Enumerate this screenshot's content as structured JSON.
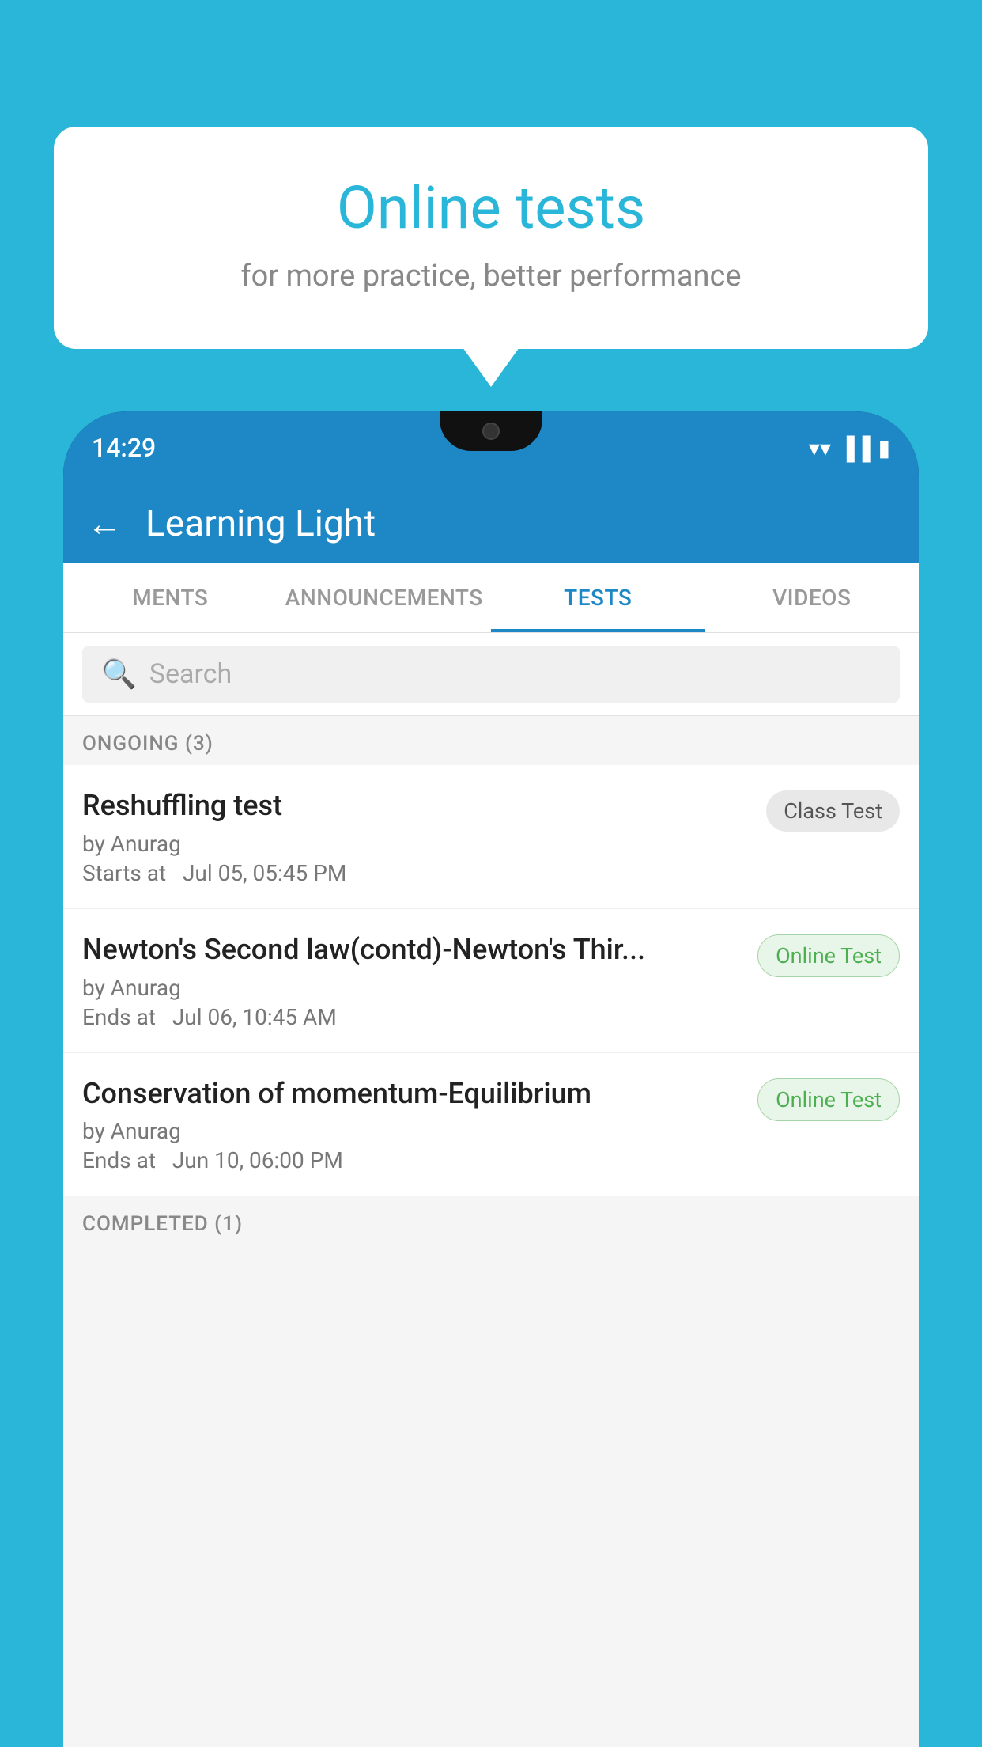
{
  "background": {
    "color": "#29b6d8"
  },
  "speechBubble": {
    "title": "Online tests",
    "subtitle": "for more practice, better performance"
  },
  "phone": {
    "statusBar": {
      "time": "14:29"
    },
    "appBar": {
      "title": "Learning Light",
      "backLabel": "←"
    },
    "tabs": [
      {
        "label": "MENTS",
        "active": false
      },
      {
        "label": "ANNOUNCEMENTS",
        "active": false
      },
      {
        "label": "TESTS",
        "active": true
      },
      {
        "label": "VIDEOS",
        "active": false
      }
    ],
    "search": {
      "placeholder": "Search"
    },
    "sections": [
      {
        "header": "ONGOING (3)",
        "tests": [
          {
            "name": "Reshuffling test",
            "author": "by Anurag",
            "timeLabel": "Starts at",
            "time": "Jul 05, 05:45 PM",
            "badge": "Class Test",
            "badgeType": "class"
          },
          {
            "name": "Newton's Second law(contd)-Newton's Thir...",
            "author": "by Anurag",
            "timeLabel": "Ends at",
            "time": "Jul 06, 10:45 AM",
            "badge": "Online Test",
            "badgeType": "online"
          },
          {
            "name": "Conservation of momentum-Equilibrium",
            "author": "by Anurag",
            "timeLabel": "Ends at",
            "time": "Jun 10, 06:00 PM",
            "badge": "Online Test",
            "badgeType": "online"
          }
        ]
      }
    ],
    "completedHeader": "COMPLETED (1)"
  }
}
